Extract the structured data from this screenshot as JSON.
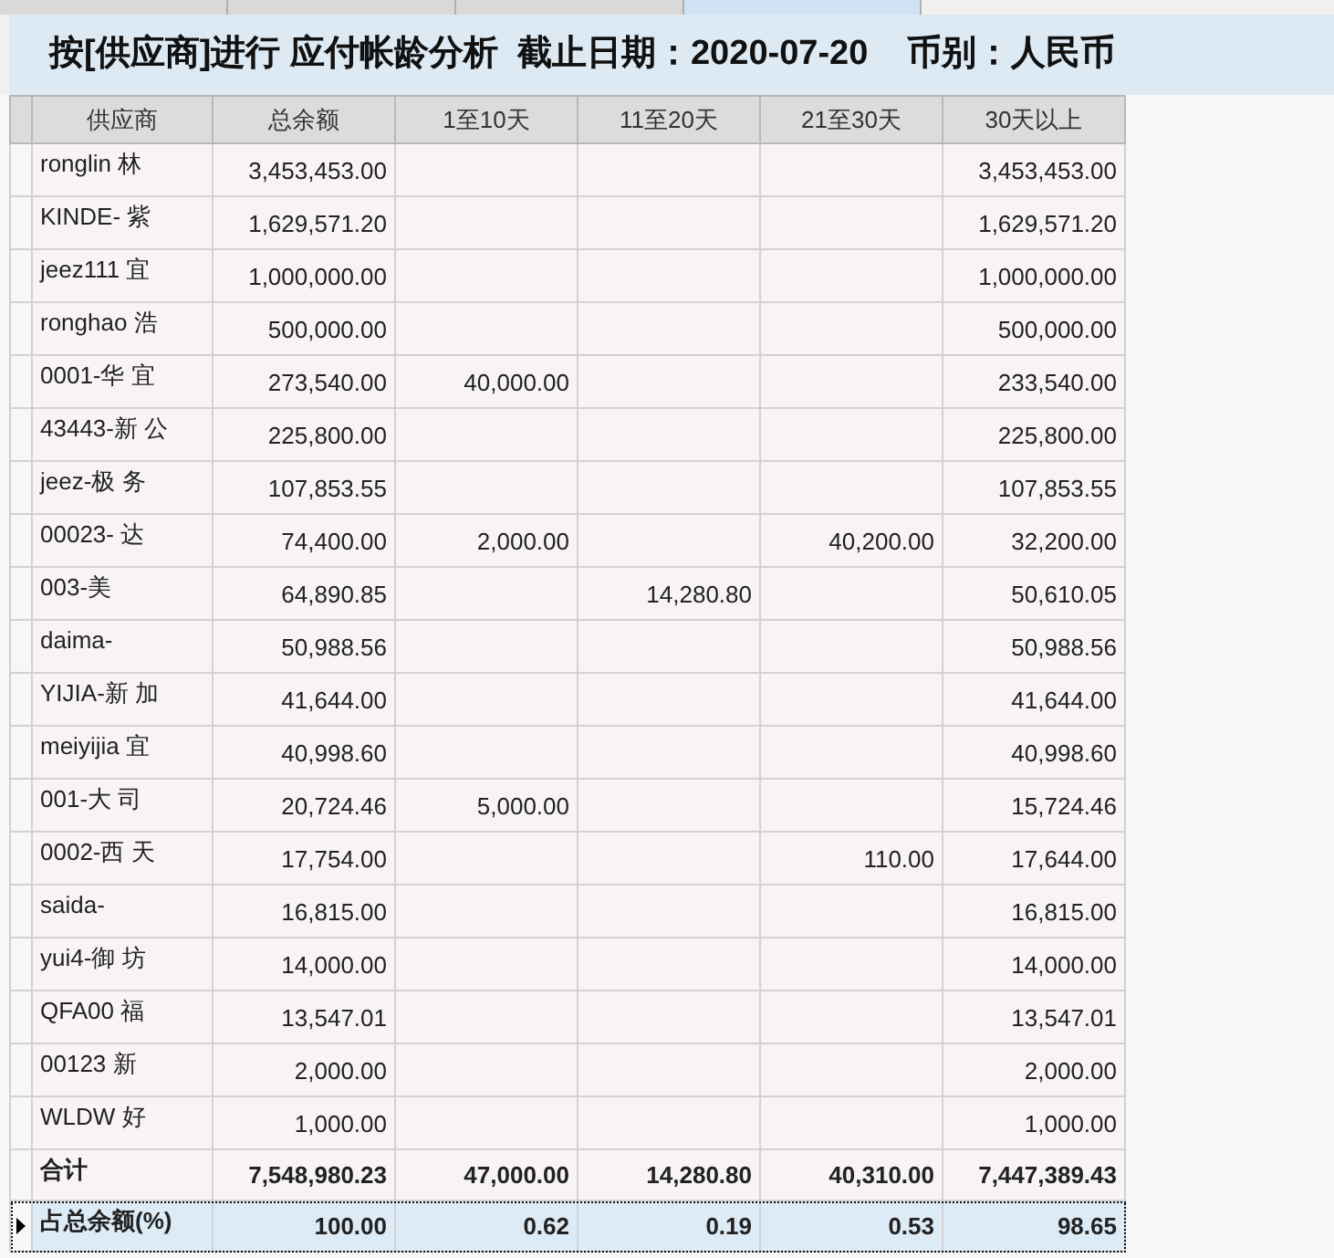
{
  "tabs": [
    {
      "selected": false
    },
    {
      "selected": false
    },
    {
      "selected": false
    },
    {
      "selected": true
    }
  ],
  "title": "按[供应商]进行 应付帐龄分析  截止日期：2020-07-20    币别：人民币",
  "table": {
    "columns": [
      "供应商",
      "总余额",
      "1至10天",
      "11至20天",
      "21至30天",
      "30天以上"
    ],
    "rows": [
      {
        "cells": {
          "supplier": "ronglin 林",
          "total": "3,453,453.00",
          "over_30": "3,453,453.00"
        },
        "selected": false
      },
      {
        "cells": {
          "supplier": "KINDE- 紫",
          "total": "1,629,571.20",
          "over_30": "1,629,571.20"
        },
        "selected": false
      },
      {
        "cells": {
          "supplier": "jeez111 宜",
          "total": "1,000,000.00",
          "over_30": "1,000,000.00"
        },
        "selected": false
      },
      {
        "cells": {
          "supplier": "ronghao 浩",
          "total": "500,000.00",
          "over_30": "500,000.00"
        },
        "selected": false
      },
      {
        "cells": {
          "supplier": "0001-华 宜",
          "total": "273,540.00",
          "d1_10": "40,000.00",
          "over_30": "233,540.00"
        },
        "selected": false
      },
      {
        "cells": {
          "supplier": "43443-新 公",
          "total": "225,800.00",
          "over_30": "225,800.00"
        },
        "selected": false
      },
      {
        "cells": {
          "supplier": "jeez-极 务",
          "total": "107,853.55",
          "over_30": "107,853.55"
        },
        "selected": false
      },
      {
        "cells": {
          "supplier": "00023- 达",
          "total": "74,400.00",
          "d1_10": "2,000.00",
          "d21_30": "40,200.00",
          "over_30": "32,200.00"
        },
        "selected": false
      },
      {
        "cells": {
          "supplier": "003-美",
          "total": "64,890.85",
          "d11_20": "14,280.80",
          "over_30": "50,610.05"
        },
        "selected": false
      },
      {
        "cells": {
          "supplier": "daima-",
          "total": "50,988.56",
          "over_30": "50,988.56"
        },
        "selected": false
      },
      {
        "cells": {
          "supplier": "YIJIA-新 加",
          "total": "41,644.00",
          "over_30": "41,644.00"
        },
        "selected": false
      },
      {
        "cells": {
          "supplier": "meiyijia 宜",
          "total": "40,998.60",
          "over_30": "40,998.60"
        },
        "selected": false
      },
      {
        "cells": {
          "supplier": "001-大 司",
          "total": "20,724.46",
          "d1_10": "5,000.00",
          "over_30": "15,724.46"
        },
        "selected": false
      },
      {
        "cells": {
          "supplier": "0002-西 天",
          "total": "17,754.00",
          "d21_30": "110.00",
          "over_30": "17,644.00"
        },
        "selected": false
      },
      {
        "cells": {
          "supplier": "saida-",
          "total": "16,815.00",
          "over_30": "16,815.00"
        },
        "selected": false
      },
      {
        "cells": {
          "supplier": "yui4-御 坊",
          "total": "14,000.00",
          "over_30": "14,000.00"
        },
        "selected": false
      },
      {
        "cells": {
          "supplier": "QFA00 福",
          "total": "13,547.01",
          "over_30": "13,547.01"
        },
        "selected": false
      },
      {
        "cells": {
          "supplier": "00123 新",
          "total": "2,000.00",
          "over_30": "2,000.00"
        },
        "selected": false
      },
      {
        "cells": {
          "supplier": "WLDW 好",
          "total": "1,000.00",
          "over_30": "1,000.00"
        },
        "selected": false
      }
    ],
    "summary_rows": [
      {
        "cells": {
          "supplier": "合计",
          "total": "7,548,980.23",
          "d1_10": "47,000.00",
          "d11_20": "14,280.80",
          "d21_30": "40,310.00",
          "over_30": "7,447,389.43"
        },
        "selected": false
      },
      {
        "cells": {
          "supplier": "占总余额(%)",
          "total": "100.00",
          "d1_10": "0.62",
          "d11_20": "0.19",
          "d21_30": "0.53",
          "over_30": "98.65"
        },
        "selected": true
      }
    ]
  }
}
